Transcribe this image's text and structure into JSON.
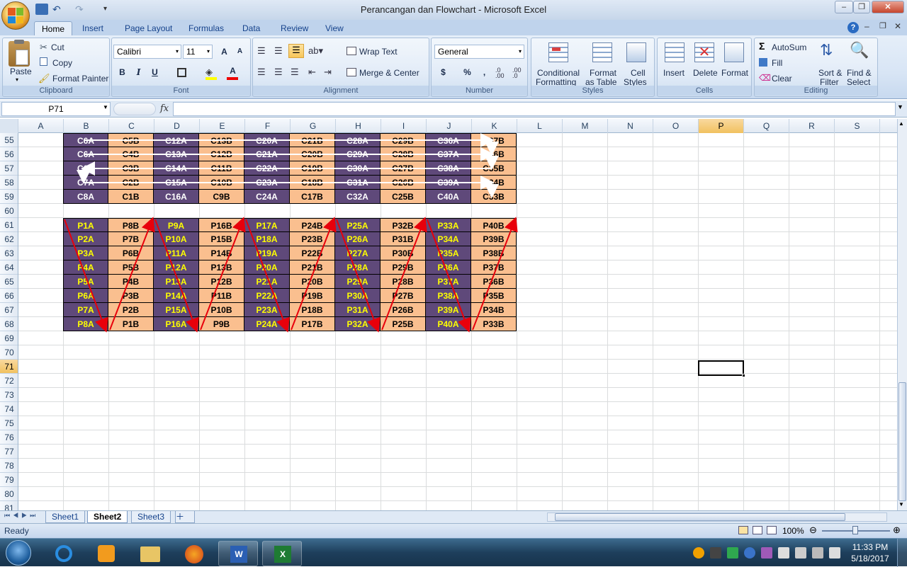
{
  "window": {
    "title": "Perancangan dan Flowchart - Microsoft Excel"
  },
  "ribbon": {
    "tabs": [
      "Home",
      "Insert",
      "Page Layout",
      "Formulas",
      "Data",
      "Review",
      "View"
    ],
    "active_tab": "Home",
    "clipboard": {
      "paste": "Paste",
      "cut": "Cut",
      "copy": "Copy",
      "format_painter": "Format Painter",
      "label": "Clipboard"
    },
    "font": {
      "name": "Calibri",
      "size": "11",
      "label": "Font",
      "bold": "B",
      "italic": "I",
      "underline": "U",
      "grow": "A",
      "shrink": "A",
      "font_color": "A"
    },
    "alignment": {
      "wrap_text": "Wrap Text",
      "merge_center": "Merge & Center",
      "label": "Alignment"
    },
    "number": {
      "format": "General",
      "currency": "$",
      "percent": "%",
      "comma": ",",
      "inc_dec": ".0 .00",
      "dec_dec": ".00 .0",
      "label": "Number"
    },
    "styles": {
      "conditional": "Conditional",
      "conditional2": "Formatting",
      "format_as": "Format",
      "format_as2": "as Table",
      "cell": "Cell",
      "cell2": "Styles",
      "label": "Styles"
    },
    "cells": {
      "insert": "Insert",
      "delete": "Delete",
      "format": "Format",
      "label": "Cells"
    },
    "editing": {
      "autosum": "AutoSum",
      "fill": "Fill",
      "clear": "Clear",
      "sort": "Sort &",
      "sort2": "Filter",
      "find": "Find &",
      "find2": "Select",
      "label": "Editing"
    }
  },
  "formula_bar": {
    "name_box": "P71",
    "fx": "fx",
    "formula": ""
  },
  "columns": [
    "A",
    "B",
    "C",
    "D",
    "E",
    "F",
    "G",
    "H",
    "I",
    "J",
    "K",
    "L",
    "M",
    "N",
    "O",
    "P",
    "Q",
    "R",
    "S"
  ],
  "selected_column": "P",
  "rows": [
    "55",
    "56",
    "57",
    "58",
    "59",
    "60",
    "61",
    "62",
    "63",
    "64",
    "65",
    "66",
    "67",
    "68",
    "69",
    "70",
    "71",
    "72",
    "73",
    "74",
    "75",
    "76",
    "77",
    "78",
    "79",
    "80",
    "81"
  ],
  "selected_row": "71",
  "table_c": [
    [
      "C6A",
      "C5B",
      "C12A",
      "C13B",
      "C20A",
      "C21B",
      "C28A",
      "C29B",
      "C36A",
      "C37B"
    ],
    [
      "C6A",
      "C4B",
      "C13A",
      "C12B",
      "C21A",
      "C20B",
      "C29A",
      "C28B",
      "C37A",
      "C36B"
    ],
    [
      "C6A",
      "C3B",
      "C14A",
      "C11B",
      "C22A",
      "C19B",
      "C30A",
      "C27B",
      "C38A",
      "C35B"
    ],
    [
      "C7A",
      "C2B",
      "C15A",
      "C10B",
      "C23A",
      "C18B",
      "C31A",
      "C26B",
      "C39A",
      "C34B"
    ],
    [
      "C8A",
      "C1B",
      "C16A",
      "C9B",
      "C24A",
      "C17B",
      "C32A",
      "C25B",
      "C40A",
      "C33B"
    ]
  ],
  "table_p": [
    [
      "P1A",
      "P8B",
      "P9A",
      "P16B",
      "P17A",
      "P24B",
      "P25A",
      "P32B",
      "P33A",
      "P40B"
    ],
    [
      "P2A",
      "P7B",
      "P10A",
      "P15B",
      "P18A",
      "P23B",
      "P26A",
      "P31B",
      "P34A",
      "P39B"
    ],
    [
      "P3A",
      "P6B",
      "P11A",
      "P14B",
      "P19A",
      "P22B",
      "P27A",
      "P30B",
      "P35A",
      "P38B"
    ],
    [
      "P4A",
      "P5B",
      "P12A",
      "P13B",
      "P20A",
      "P21B",
      "P28A",
      "P29B",
      "P36A",
      "P37B"
    ],
    [
      "P5A",
      "P4B",
      "P13A",
      "P12B",
      "P21A",
      "P20B",
      "P29A",
      "P28B",
      "P37A",
      "P36B"
    ],
    [
      "P6A",
      "P3B",
      "P14A",
      "P11B",
      "P22A",
      "P19B",
      "P30A",
      "P27B",
      "P38A",
      "P35B"
    ],
    [
      "P7A",
      "P2B",
      "P15A",
      "P10B",
      "P23A",
      "P18B",
      "P31A",
      "P26B",
      "P39A",
      "P34B"
    ],
    [
      "P8A",
      "P1B",
      "P16A",
      "P9B",
      "P24A",
      "P17B",
      "P32A",
      "P25B",
      "P40A",
      "P33B"
    ]
  ],
  "colors": {
    "purple": "#5f497a",
    "peach": "#fabf8f",
    "yellow_text": "#ffff00",
    "arrow_red": "#e8000b"
  },
  "sheets": [
    "Sheet1",
    "Sheet2",
    "Sheet3"
  ],
  "active_sheet": "Sheet2",
  "status": {
    "ready": "Ready",
    "zoom": "100%"
  },
  "taskbar": {
    "time": "11:33 PM",
    "date": "5/18/2017"
  }
}
